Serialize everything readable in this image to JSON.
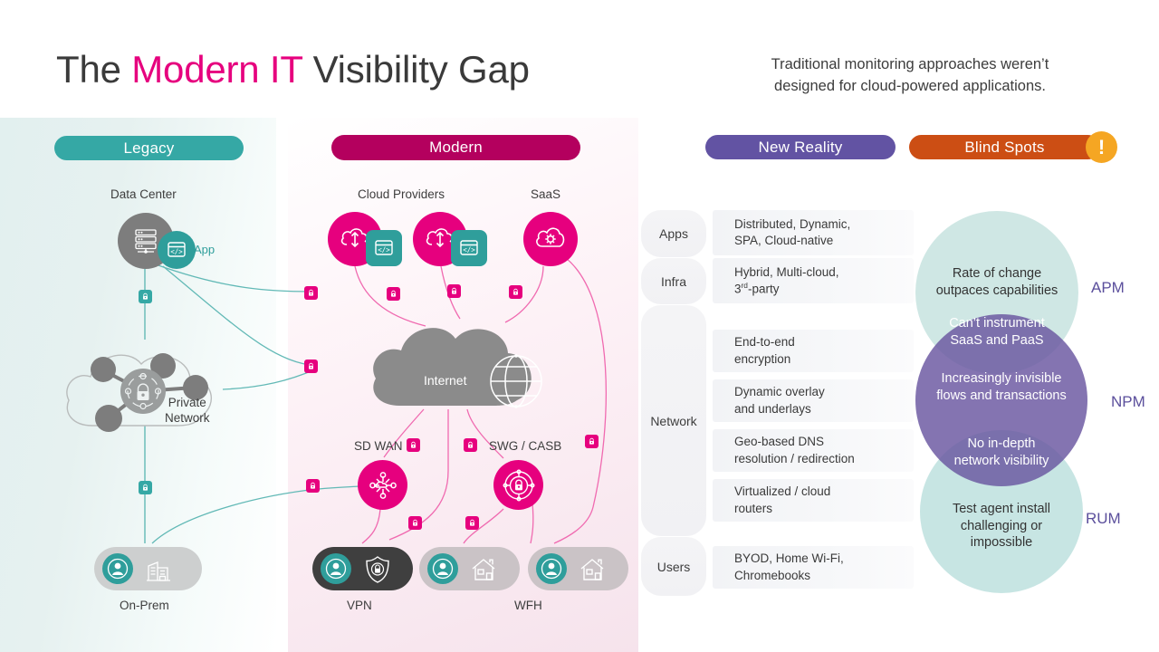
{
  "header": {
    "title_prefix": "The ",
    "title_highlight": "Modern IT",
    "title_suffix": " Visibility Gap",
    "subtitle_line1": "Traditional monitoring approaches weren’t",
    "subtitle_line2": "designed for cloud-powered applications."
  },
  "pills": {
    "legacy": "Legacy",
    "modern": "Modern",
    "new_reality": "New Reality",
    "blind_spots": "Blind Spots",
    "warning_glyph": "!"
  },
  "legacy": {
    "data_center_label": "Data Center",
    "app_label": "App",
    "private_network_line1": "Private",
    "private_network_line2": "Network",
    "on_prem_label": "On-Prem"
  },
  "modern": {
    "cloud_providers_label": "Cloud Providers",
    "saas_label": "SaaS",
    "internet_label": "Internet",
    "sdwan_label": "SD WAN",
    "swg_casb_label": "SWG / CASB",
    "vpn_label": "VPN",
    "wfh_label": "WFH"
  },
  "table": {
    "categories": [
      {
        "label": "Apps"
      },
      {
        "label": "Infra"
      },
      {
        "label": "Network"
      },
      {
        "label": "Users"
      }
    ],
    "rows": [
      {
        "line1": "Distributed, Dynamic,",
        "line2": "SPA, Cloud-native"
      },
      {
        "line1": "Hybrid, Multi-cloud,",
        "line2": "3rd-party",
        "line2_sup": "rd"
      },
      {
        "line1": "End-to-end",
        "line2": "encryption"
      },
      {
        "line1": "Dynamic overlay",
        "line2": "and underlays"
      },
      {
        "line1": "Geo-based DNS",
        "line2": "resolution / redirection"
      },
      {
        "line1": "Virtualized / cloud",
        "line2": "routers"
      },
      {
        "line1": "BYOD, Home Wi-Fi,",
        "line2": "Chromebooks"
      }
    ]
  },
  "venn": {
    "apm_line1": "Rate of change",
    "apm_line2": "outpaces capabilities",
    "apm_tag": "APM",
    "apm_npm_line1": "Can’t instrument",
    "apm_npm_line2": "SaaS and PaaS",
    "npm_line1": "Increasingly invisible",
    "npm_line2": "flows and transactions",
    "npm_tag": "NPM",
    "npm_rum_line1": "No in-depth",
    "npm_rum_line2": "network visibility",
    "rum_line1": "Test agent install",
    "rum_line2": "challenging or",
    "rum_line3": "impossible",
    "rum_tag": "RUM"
  },
  "colors": {
    "pink": "#e6007e",
    "magenta_dark": "#b4005e",
    "teal": "#35a8a5",
    "purple": "#6253a3",
    "orange": "#cc4e14",
    "amber": "#f5a623",
    "grey": "#7d7d7d"
  }
}
